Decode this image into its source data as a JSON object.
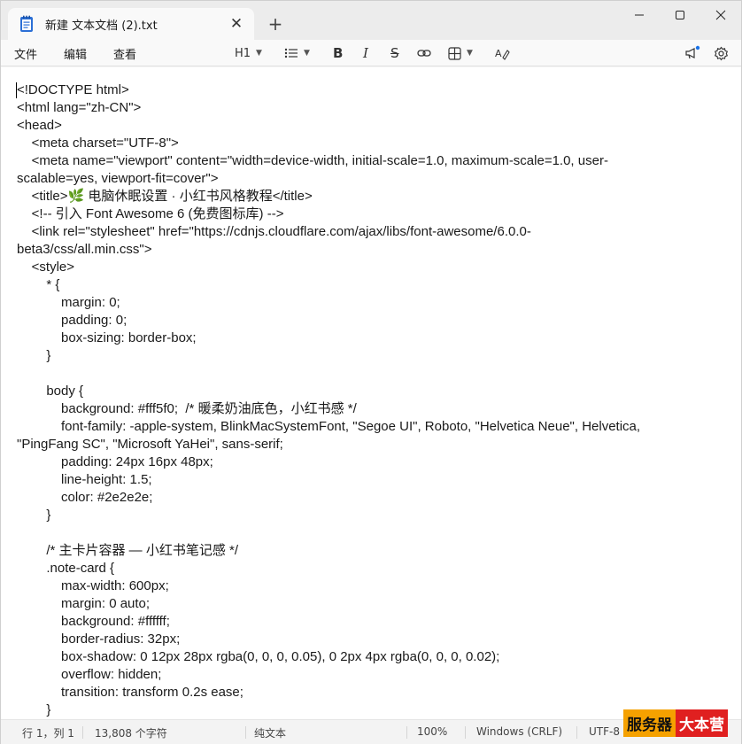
{
  "tab": {
    "title": "新建 文本文档 (2).txt",
    "close": "✕",
    "new_tab": "+"
  },
  "window_controls": {
    "minimize": "─",
    "maximize": "☐",
    "close": "✕"
  },
  "menu": {
    "file": "文件",
    "edit": "编辑",
    "view": "查看"
  },
  "toolbar": {
    "heading": "H1"
  },
  "editor_lines": [
    "<!DOCTYPE html>",
    "<html lang=\"zh-CN\">",
    "<head>",
    "    <meta charset=\"UTF-8\">",
    "    <meta name=\"viewport\" content=\"width=device-width, initial-scale=1.0, maximum-scale=1.0, user-",
    "scalable=yes, viewport-fit=cover\">",
    "    <title>🌿 电脑休眠设置 · 小红书风格教程</title>",
    "    <!-- 引入 Font Awesome 6 (免费图标库) -->",
    "    <link rel=\"stylesheet\" href=\"https://cdnjs.cloudflare.com/ajax/libs/font-awesome/6.0.0-",
    "beta3/css/all.min.css\">",
    "    <style>",
    "        * {",
    "            margin: 0;",
    "            padding: 0;",
    "            box-sizing: border-box;",
    "        }",
    "",
    "        body {",
    "            background: #fff5f0;  /* 暖柔奶油底色，小红书感 */",
    "            font-family: -apple-system, BlinkMacSystemFont, \"Segoe UI\", Roboto, \"Helvetica Neue\", Helvetica,",
    "\"PingFang SC\", \"Microsoft YaHei\", sans-serif;",
    "            padding: 24px 16px 48px;",
    "            line-height: 1.5;",
    "            color: #2e2e2e;",
    "        }",
    "",
    "        /* 主卡片容器 — 小红书笔记感 */",
    "        .note-card {",
    "            max-width: 600px;",
    "            margin: 0 auto;",
    "            background: #ffffff;",
    "            border-radius: 32px;",
    "            box-shadow: 0 12px 28px rgba(0, 0, 0, 0.05), 0 2px 4px rgba(0, 0, 0, 0.02);",
    "            overflow: hidden;",
    "            transition: transform 0.2s ease;",
    "        }"
  ],
  "status": {
    "position": "行 1，列 1",
    "char_count": "13,808 个字符",
    "format": "纯文本",
    "zoom": "100%",
    "line_ending": "Windows (CRLF)",
    "encoding": "UTF-8"
  },
  "watermark": {
    "part1": "服务器",
    "part2": "大本营"
  },
  "colors": {
    "accent_dot": "#1a73e8",
    "watermark_orange": "#f5a100",
    "watermark_red": "#e02020"
  }
}
